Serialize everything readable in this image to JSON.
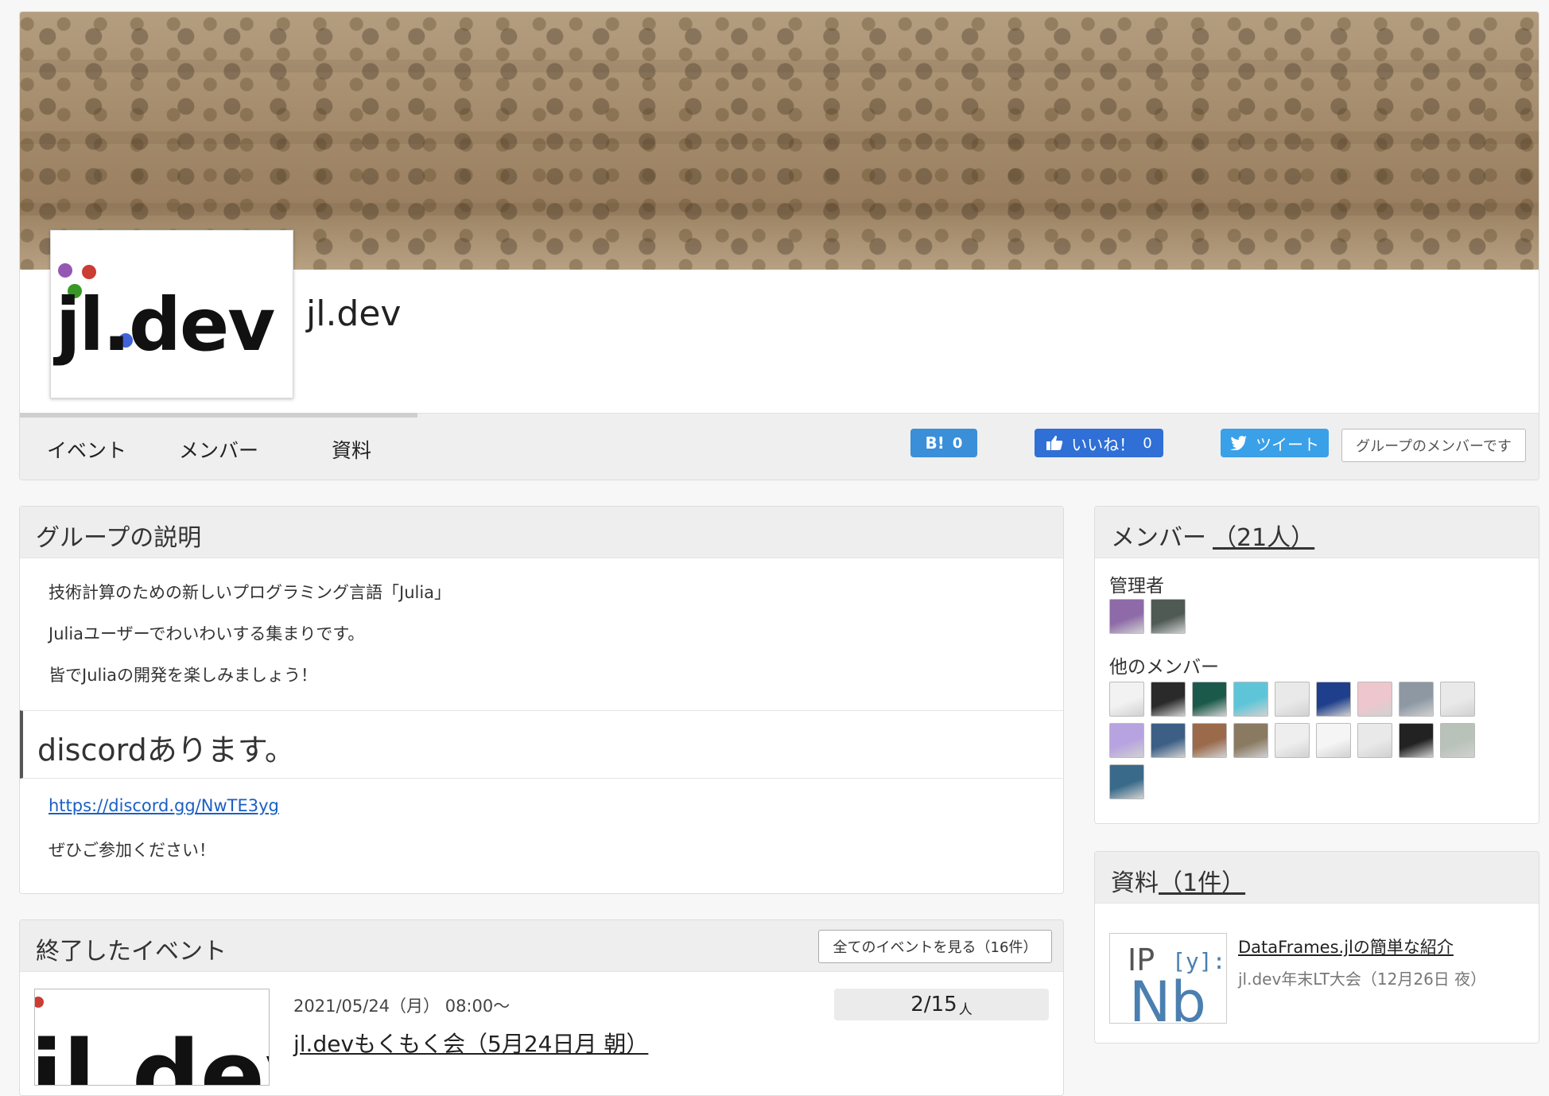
{
  "group": {
    "name": "jl.dev",
    "logo_text": "jl.dev"
  },
  "nav": {
    "tabs": [
      "イベント",
      "メンバー",
      "資料"
    ]
  },
  "share": {
    "hatena_label": "B!",
    "hatena_count": "0",
    "like_label": "いいね！",
    "like_count": "0",
    "tweet_label": "ツイート",
    "member_status": "グループのメンバーです"
  },
  "description": {
    "title": "グループの説明",
    "lines": [
      "技術計算のための新しいプログラミング言語「Julia」",
      "Juliaユーザーでわいわいする集まりです。",
      "皆でJuliaの開発を楽しみましょう！"
    ],
    "discord_heading": "discordあります。",
    "discord_link": "https://discord.gg/NwTE3yg",
    "closing": "ぜひご参加ください！"
  },
  "events": {
    "title": "終了したイベント",
    "all_button": "全てのイベントを見る（16件）",
    "items": [
      {
        "date": "2021/05/24（月） 08:00〜",
        "title": "jl.devもくもく会（5月24日月 朝）",
        "capacity": "2/15",
        "capacity_unit": "人"
      }
    ]
  },
  "members": {
    "title": "メンバー",
    "count": "（21人）",
    "admins_label": "管理者",
    "others_label": "他のメンバー",
    "admin_avatars": [
      "#8e6aa8",
      "#4f5a55"
    ],
    "other_avatars": [
      "#f2f2f2",
      "#2a2a2a",
      "#1b5a4a",
      "#5ec5d8",
      "#e9e9e9",
      "#1f3f8c",
      "#eec6cd",
      "#8d98a3",
      "#e9e9e9",
      "#b7a3e0",
      "#3d5f86",
      "#9a6a4a",
      "#8a7a62",
      "#eeeeee",
      "#f5f5f5",
      "#e9e9e9",
      "#222222",
      "#b8c2b8",
      "#3a6a8a"
    ]
  },
  "docs": {
    "title": "資料",
    "count": "（1件）",
    "items": [
      {
        "title": "DataFrames.jlの簡単な紹介",
        "event": "jl.dev年末LT大会（12月26日 夜）"
      }
    ]
  },
  "colors": {
    "hatena": "#3a8fd8",
    "like": "#2f6fd6",
    "tweet": "#3aa0e8",
    "link": "#1a5fc2"
  }
}
